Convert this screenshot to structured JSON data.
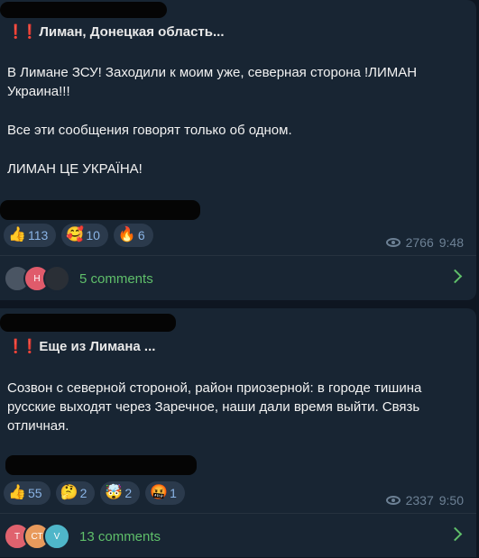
{
  "posts": [
    {
      "title": "Лиман, Донецкая область...",
      "body": [
        "В Лимане ЗСУ! Заходили к моим уже, северная сторона !ЛИМАН Украина!!!",
        "Все эти сообщения говорят только об одном.",
        "ЛИМАН ЦЕ УКРАЇНА!"
      ],
      "reactions": [
        {
          "emoji": "👍",
          "count": "113"
        },
        {
          "emoji": "🥰",
          "count": "10"
        },
        {
          "emoji": "🔥",
          "count": "6"
        }
      ],
      "views": "2766",
      "time": "9:48",
      "avatars": [
        "",
        "Н",
        ""
      ],
      "comments": "5 comments"
    },
    {
      "title": "Еще из Лимана ...",
      "body": [
        "Созвон с северной стороной, район приозерной: в городе тишина русские выходят через Заречное, наши дали время выйти. Связь отличная."
      ],
      "reactions": [
        {
          "emoji": "👍",
          "count": "55"
        },
        {
          "emoji": "🤔",
          "count": "2"
        },
        {
          "emoji": "🤯",
          "count": "2"
        },
        {
          "emoji": "🤬",
          "count": "1"
        }
      ],
      "views": "2337",
      "time": "9:50",
      "avatars": [
        "Т",
        "СТ",
        "V"
      ],
      "comments": "13 comments"
    }
  ],
  "colors": {
    "accent_green": "#5fbf6a",
    "reaction_text": "#8ab4e6",
    "alert_red": "#e23a3a"
  },
  "icons": {
    "views": "eye-icon",
    "comments_arrow": "chevron-right-icon",
    "alert": "double-exclamation-icon"
  }
}
